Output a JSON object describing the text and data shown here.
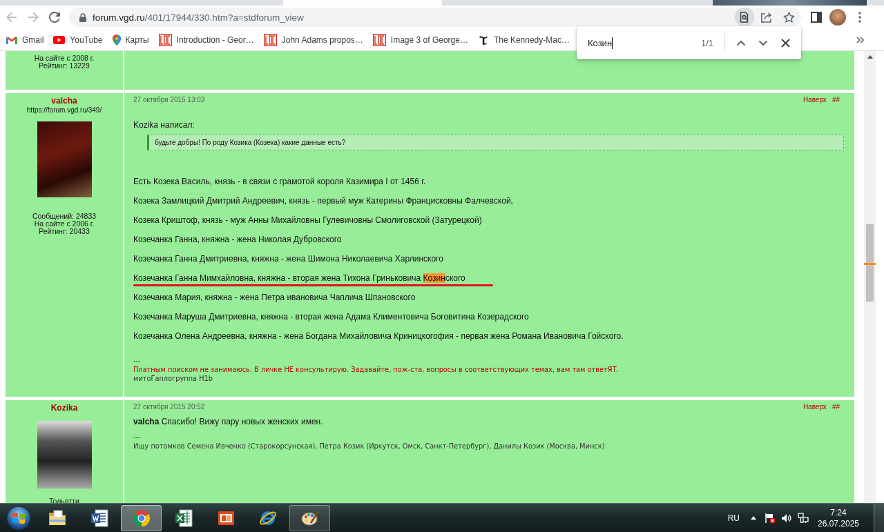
{
  "browser": {
    "back": {
      "disabled": true
    },
    "forward": {
      "disabled": true
    },
    "url": {
      "host": "forum.vgd.ru",
      "path": "/401/17944/330.htm?a=stdforum_view"
    }
  },
  "bookmarks": [
    {
      "kind": "gmail",
      "label": "Gmail"
    },
    {
      "kind": "youtube",
      "label": "YouTube"
    },
    {
      "kind": "maps",
      "label": "Карты"
    },
    {
      "kind": "loc",
      "label": "Introduction - Geor…"
    },
    {
      "kind": "loc",
      "label": "John Adams propos…"
    },
    {
      "kind": "loc",
      "label": "Image 3 of George…"
    },
    {
      "kind": "nyt",
      "label": "The Kennedy-Mac…"
    }
  ],
  "find_bar": {
    "query": "Козин",
    "count": "1/1"
  },
  "posts": [
    {
      "stats": [
        "На сайте с 2008 г.",
        "Рейтинг: 13229"
      ]
    },
    {
      "author": "valcha",
      "profile_url": "https://forum.vgd.ru/349/",
      "stats": [
        "Сообщений: 24833",
        "На сайте с 2006 г.",
        "Рейтинг: 20433"
      ],
      "date": "27 октября 2015 13:03",
      "top_link": "Наверх",
      "anchor": "##",
      "quote_author": "Kozika написал:",
      "quote": "будьте добры! По роду Козика (Козека) какие данные есть?",
      "paragraphs": [
        {
          "text": "Есть Козека Василь, князь - в связи с грамотой короля Казимира I от 1456 г.",
          "underlined": false
        },
        {
          "text": "Козека Замлицкий Дмитрий Андреевич, князь - первый муж Катерины Францисковны Фалчевской,",
          "underlined": false
        },
        {
          "text": "Козека Криштоф, князь - муж Анны Михайловны Гулевичовны Смолиговской (Затурецкой)",
          "underlined": false
        },
        {
          "text": "Козечанка Ганна, княжна - жена Николая Дубровского",
          "underlined": false
        },
        {
          "text": "Козечанка Ганна Дмитриевна, княжна - жена Шимона Николаевича Харлинского",
          "underlined": false
        },
        {
          "text": "Козечанка Ганна Мимхайловна, княжна - вторая жена Тихона Гриньковича ",
          "match": "Козин",
          "after": "ского",
          "underlined": true
        },
        {
          "text": "Козечанка Мария, княжна - жена Петра ивановича Чаплича Шпановского",
          "underlined": false
        },
        {
          "text": "Козечанка Маруша Дмитриевна, княжна - вторая жена Адама Климентовича Боговитина Козерадского",
          "underlined": false
        },
        {
          "text": "Козечанка Олена Андреевна, княжна - жена Богдана Михайловича Криницкогофия - первая жена Романа Ивановича Гойского.",
          "underlined": false
        }
      ],
      "separator": "---",
      "signature": [
        {
          "text": "Платным поиском не занимаюсь. В личке НЕ консультирую. Задавайте, пож-ста, вопросы в соответствующих темах, вам там ответЯТ.",
          "color": "#b00000"
        },
        {
          "text": "митоГаплогруппа H1b",
          "color": "#333333"
        }
      ]
    },
    {
      "author": "Kozika",
      "stats": [
        "Тольятти"
      ],
      "date": "27 октября 2015 20:52",
      "top_link": "Наверх",
      "anchor": "##",
      "paragraphs": [
        {
          "text": "**valcha** Спасибо! Вижу пару новых женских имен.",
          "underlined": false
        }
      ],
      "separator": "---",
      "signature": [
        {
          "text": "Ищу потомков Семена Ивченко (Старокорсунская), Петра Козик (Иркутск, Омск, Санкт-Петербург), Данилы Козик (Москва, Минск)",
          "color": "#333333"
        }
      ]
    }
  ],
  "taskbar": {
    "apps": [
      {
        "kind": "explorer",
        "running": false,
        "selected": false
      },
      {
        "kind": "word",
        "running": false,
        "selected": false
      },
      {
        "kind": "chrome",
        "running": true,
        "selected": true
      },
      {
        "kind": "excel",
        "running": false,
        "selected": false
      },
      {
        "kind": "presentation",
        "running": false,
        "selected": false
      },
      {
        "kind": "ie",
        "running": false,
        "selected": false
      },
      {
        "kind": "paint",
        "running": true,
        "selected": false
      }
    ],
    "language": "RU",
    "time": "7:24",
    "date": "26.07.2025"
  }
}
